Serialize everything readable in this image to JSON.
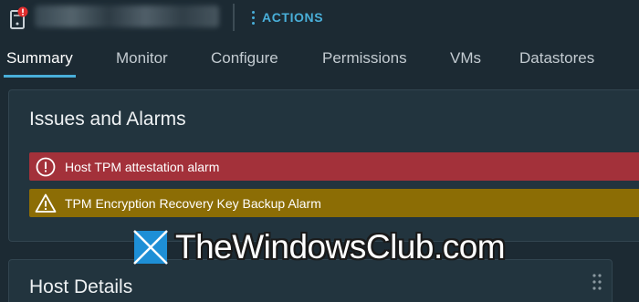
{
  "header": {
    "host_icon": "server-icon",
    "status_icon": "error-badge-icon",
    "actions_label": "ACTIONS",
    "actions_icon": "kebab-icon"
  },
  "tabs": [
    {
      "label": "Summary",
      "active": true
    },
    {
      "label": "Monitor",
      "active": false
    },
    {
      "label": "Configure",
      "active": false
    },
    {
      "label": "Permissions",
      "active": false
    },
    {
      "label": "VMs",
      "active": false
    },
    {
      "label": "Datastores",
      "active": false
    }
  ],
  "issues_panel": {
    "title": "Issues and Alarms",
    "alarms": [
      {
        "label": "Host TPM attestation alarm",
        "severity": "error",
        "icon": "error-circle-icon",
        "color": "#a3313a"
      },
      {
        "label": "TPM Encryption Recovery Key Backup Alarm",
        "severity": "warning",
        "icon": "warning-triangle-icon",
        "color": "#8c6d05"
      }
    ]
  },
  "host_panel": {
    "title": "Host Details",
    "handle_icon": "drag-handle-icon"
  },
  "watermark": {
    "text": "TheWindowsClub.com"
  },
  "colors": {
    "background": "#1c2a33",
    "panel": "#22343e",
    "accent": "#49afd9",
    "error": "#a3313a",
    "warning": "#8c6d05"
  }
}
